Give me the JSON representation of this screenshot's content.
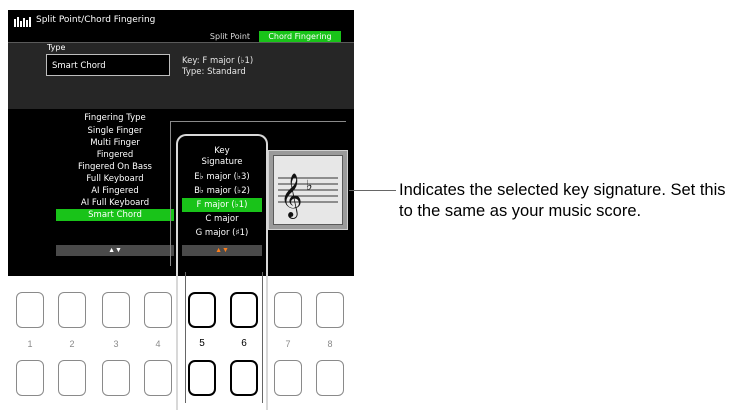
{
  "window": {
    "title": "Split Point/Chord Fingering"
  },
  "tabs": [
    {
      "label": "Split Point",
      "active": false
    },
    {
      "label": "Chord Fingering",
      "active": true
    }
  ],
  "type_section": {
    "label": "Type",
    "value": "Smart Chord",
    "key_line": "Key: F major (♭1)",
    "type_line": "Type: Standard"
  },
  "fingering": {
    "title": "Fingering Type",
    "items": [
      "Single Finger",
      "Multi Finger",
      "Fingered",
      "Fingered On Bass",
      "Full Keyboard",
      "AI Fingered",
      "AI Full Keyboard",
      "Smart Chord"
    ],
    "selected_index": 7,
    "arrows": "▲▼"
  },
  "key_signature": {
    "title_line1": "Key",
    "title_line2": "Signature",
    "items": [
      "E♭ major (♭3)",
      "B♭ major (♭2)",
      "F major (♭1)",
      "C major",
      "G major (♯1)"
    ],
    "selected_index": 2,
    "arrows": "▲▼"
  },
  "staff_display": {
    "clef": "treble-clef",
    "accidental": "♭"
  },
  "callout": {
    "text": "Indicates the selected key signature. Set this to the same as your music score."
  },
  "buttons": {
    "labels": [
      "1",
      "2",
      "3",
      "4",
      "5",
      "6",
      "7",
      "8"
    ],
    "highlighted": [
      "5",
      "6"
    ]
  },
  "colors": {
    "accent": "#19c319",
    "arrow_active": "#ff7f1a",
    "screen": "#000000"
  }
}
